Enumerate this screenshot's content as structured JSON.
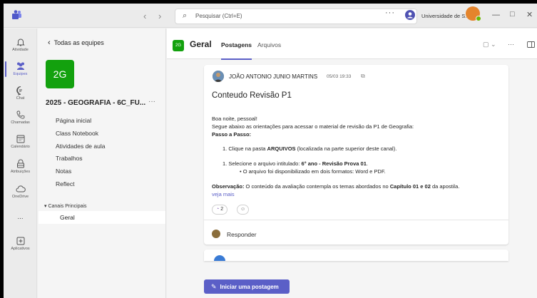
{
  "colors": {
    "accent": "#5b5fc7",
    "team_green": "#13a10e",
    "user_avatar": "#e4842c",
    "presence": "#6bb700"
  },
  "titlebar": {
    "search_placeholder": "Pesquisar (Ctrl+E)",
    "more_label": "···",
    "org_name": "Universidade de S...",
    "icons": [
      "teams-logo-icon",
      "back-arrow-icon",
      "forward-arrow-icon",
      "search-icon",
      "minimize-icon",
      "maximize-icon",
      "close-icon"
    ]
  },
  "rail": {
    "items": [
      {
        "label": "Atividade",
        "icon": "bell-icon"
      },
      {
        "label": "Equipes",
        "icon": "teams-icon",
        "active": true
      },
      {
        "label": "Chat",
        "icon": "chat-icon"
      },
      {
        "label": "Chamadas",
        "icon": "phone-icon"
      },
      {
        "label": "Calendário",
        "icon": "calendar-icon"
      },
      {
        "label": "Atribuições",
        "icon": "assignments-icon"
      },
      {
        "label": "OneDrive",
        "icon": "cloud-icon"
      },
      {
        "label": "...",
        "icon": "more-icon"
      },
      {
        "label": "Aplicativos",
        "icon": "add-app-icon"
      }
    ]
  },
  "team": {
    "back_label": "Todas as equipes",
    "initials": "2G",
    "name": "2025 - GEOGRAFIA - 6C_FU...",
    "more": "···",
    "nav": [
      "Página inicial",
      "Class Notebook",
      "Atividades de aula",
      "Trabalhos",
      "Notas",
      "Reflect"
    ],
    "channels_header": "Canais Principais",
    "channels": [
      "Geral"
    ]
  },
  "main": {
    "badge": "2G",
    "title": "Geral",
    "tabs": [
      "Postagens",
      "Arquivos"
    ],
    "more": "···"
  },
  "post": {
    "author": "JOÃO ANTONIO JUNIO MARTINS",
    "time": "05/03 19:33",
    "title": "Conteudo Revisão P1",
    "greeting": "Boa noite, pessoal!",
    "intro": "Segue abaixo as orientações para acessar o material de revisão da P1 de Geografia:",
    "steps_title": "Passo a Passo:",
    "step1_pre": "1. Clique na pasta ",
    "step1_bold": "ARQUIVOS",
    "step1_post": " (localizada na parte superior deste canal).",
    "step2_pre": "1. Selecione o arquivo intitulado: ",
    "step2_bold": "6° ano - Revisão Prova 01",
    "step2_post": ".",
    "bullet": "O arquivo foi disponibilizado em dois formatos: Word e PDF.",
    "obs_label": "Observação:",
    "obs_pre": " O conteúdo da avaliação contempla os temas abordados no ",
    "obs_bold": "Capítulo 01 e 02",
    "obs_post": " da apostila.",
    "see_more": "veja mais",
    "reaction_count": "2",
    "reply_label": "Responder"
  },
  "composer": {
    "new_post_label": "Iniciar uma postagem"
  }
}
